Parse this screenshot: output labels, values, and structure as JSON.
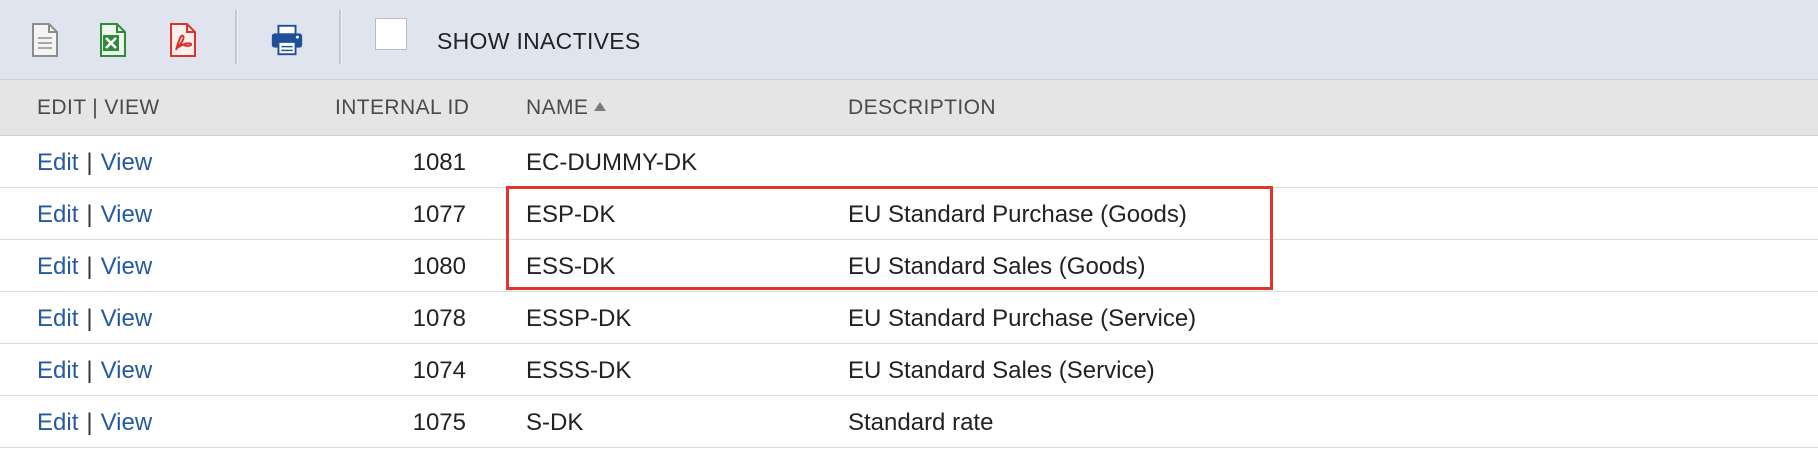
{
  "toolbar": {
    "icons": [
      "document-icon",
      "excel-icon",
      "pdf-icon",
      "print-icon"
    ],
    "show_inactives_label": "SHOW INACTIVES",
    "show_inactives_checked": false
  },
  "table": {
    "headers": {
      "edit_view": "EDIT | VIEW",
      "internal_id": "INTERNAL ID",
      "name": "NAME",
      "description": "DESCRIPTION"
    },
    "sort": {
      "column": "name",
      "direction": "ascending"
    },
    "rows": [
      {
        "edit": "Edit",
        "sep": "|",
        "view": "View",
        "id": "1081",
        "name": "EC-DUMMY-DK",
        "description": ""
      },
      {
        "edit": "Edit",
        "sep": "|",
        "view": "View",
        "id": "1077",
        "name": "ESP-DK",
        "description": "EU Standard Purchase (Goods)"
      },
      {
        "edit": "Edit",
        "sep": "|",
        "view": "View",
        "id": "1080",
        "name": "ESS-DK",
        "description": "EU Standard Sales (Goods)"
      },
      {
        "edit": "Edit",
        "sep": "|",
        "view": "View",
        "id": "1078",
        "name": "ESSP-DK",
        "description": "EU Standard Purchase (Service)"
      },
      {
        "edit": "Edit",
        "sep": "|",
        "view": "View",
        "id": "1074",
        "name": "ESSS-DK",
        "description": "EU Standard Sales (Service)"
      },
      {
        "edit": "Edit",
        "sep": "|",
        "view": "View",
        "id": "1075",
        "name": "S-DK",
        "description": "Standard rate"
      }
    ]
  },
  "colors": {
    "toolbar_bg": "#dfe4ee",
    "header_bg": "#e5e5e5",
    "link": "#255aa0",
    "highlight_box": "#e0362b",
    "excel_green": "#2e8b3a",
    "pdf_red": "#d9342b",
    "print_blue": "#1f4f99"
  }
}
